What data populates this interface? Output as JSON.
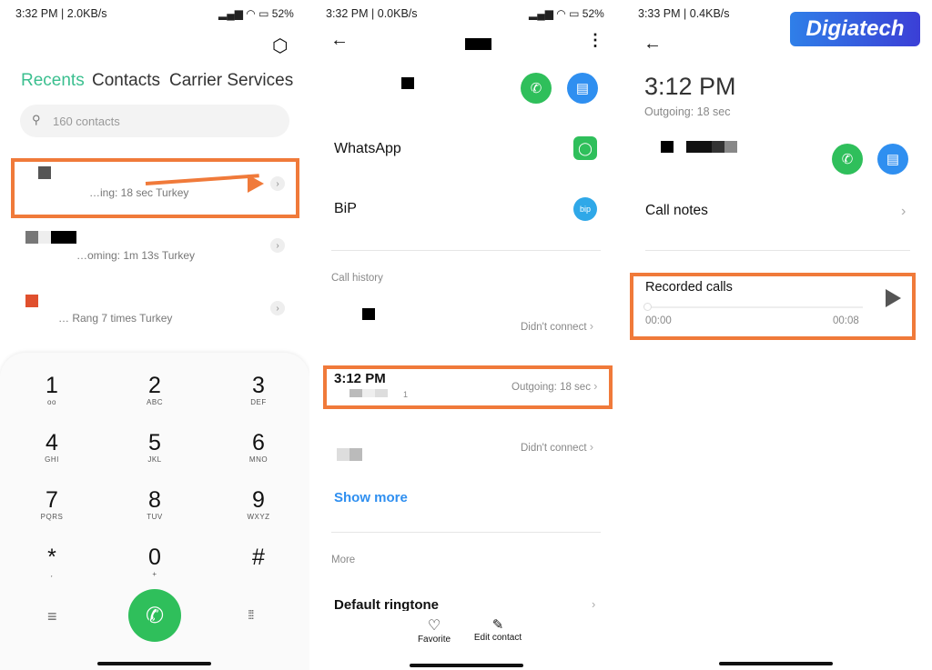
{
  "panel1": {
    "status_time": "3:32 PM | 2.0KB/s",
    "battery": "52%",
    "tabs": [
      "Recents",
      "Contacts",
      "Carrier Services"
    ],
    "search_placeholder": "160 contacts",
    "recents": [
      {
        "detail": "…ing: 18 sec Turkey"
      },
      {
        "detail": "…oming: 1m 13s Turkey"
      },
      {
        "detail": "… Rang 7 times Turkey"
      }
    ],
    "keys": [
      {
        "digit": "1",
        "letters": "ᴏᴏ"
      },
      {
        "digit": "2",
        "letters": "ABC"
      },
      {
        "digit": "3",
        "letters": "DEF"
      },
      {
        "digit": "4",
        "letters": "GHI"
      },
      {
        "digit": "5",
        "letters": "JKL"
      },
      {
        "digit": "6",
        "letters": "MNO"
      },
      {
        "digit": "7",
        "letters": "PQRS"
      },
      {
        "digit": "8",
        "letters": "TUV"
      },
      {
        "digit": "9",
        "letters": "WXYZ"
      },
      {
        "digit": "*",
        "letters": ","
      },
      {
        "digit": "0",
        "letters": "+"
      },
      {
        "digit": "#",
        "letters": ""
      }
    ],
    "accent": "#3bbf8f"
  },
  "panel2": {
    "status_time": "3:32 PM | 0.0KB/s",
    "battery": "52%",
    "apps": [
      "WhatsApp",
      "BiP"
    ],
    "call_history_label": "Call history",
    "history": [
      {
        "time": "",
        "status": "Didn't connect"
      },
      {
        "time": "3:12 PM",
        "sub": "1",
        "status": "Outgoing: 18 sec"
      },
      {
        "time": "",
        "status": "Didn't connect"
      }
    ],
    "show_more": "Show more",
    "more_label": "More",
    "default_ringtone": "Default ringtone",
    "favorite": "Favorite",
    "edit_contact": "Edit contact"
  },
  "panel3": {
    "status_time": "3:33 PM | 0.4KB/s",
    "call_time": "3:12 PM",
    "call_detail": "Outgoing: 18 sec",
    "call_notes": "Call notes",
    "recorded_calls": "Recorded calls",
    "position": "00:00",
    "duration": "00:08",
    "progress": 0
  },
  "logo": "Digiatech",
  "colors": {
    "highlight": "#f07a3a",
    "green": "#2fbf5b",
    "blue": "#2f8ff0"
  }
}
